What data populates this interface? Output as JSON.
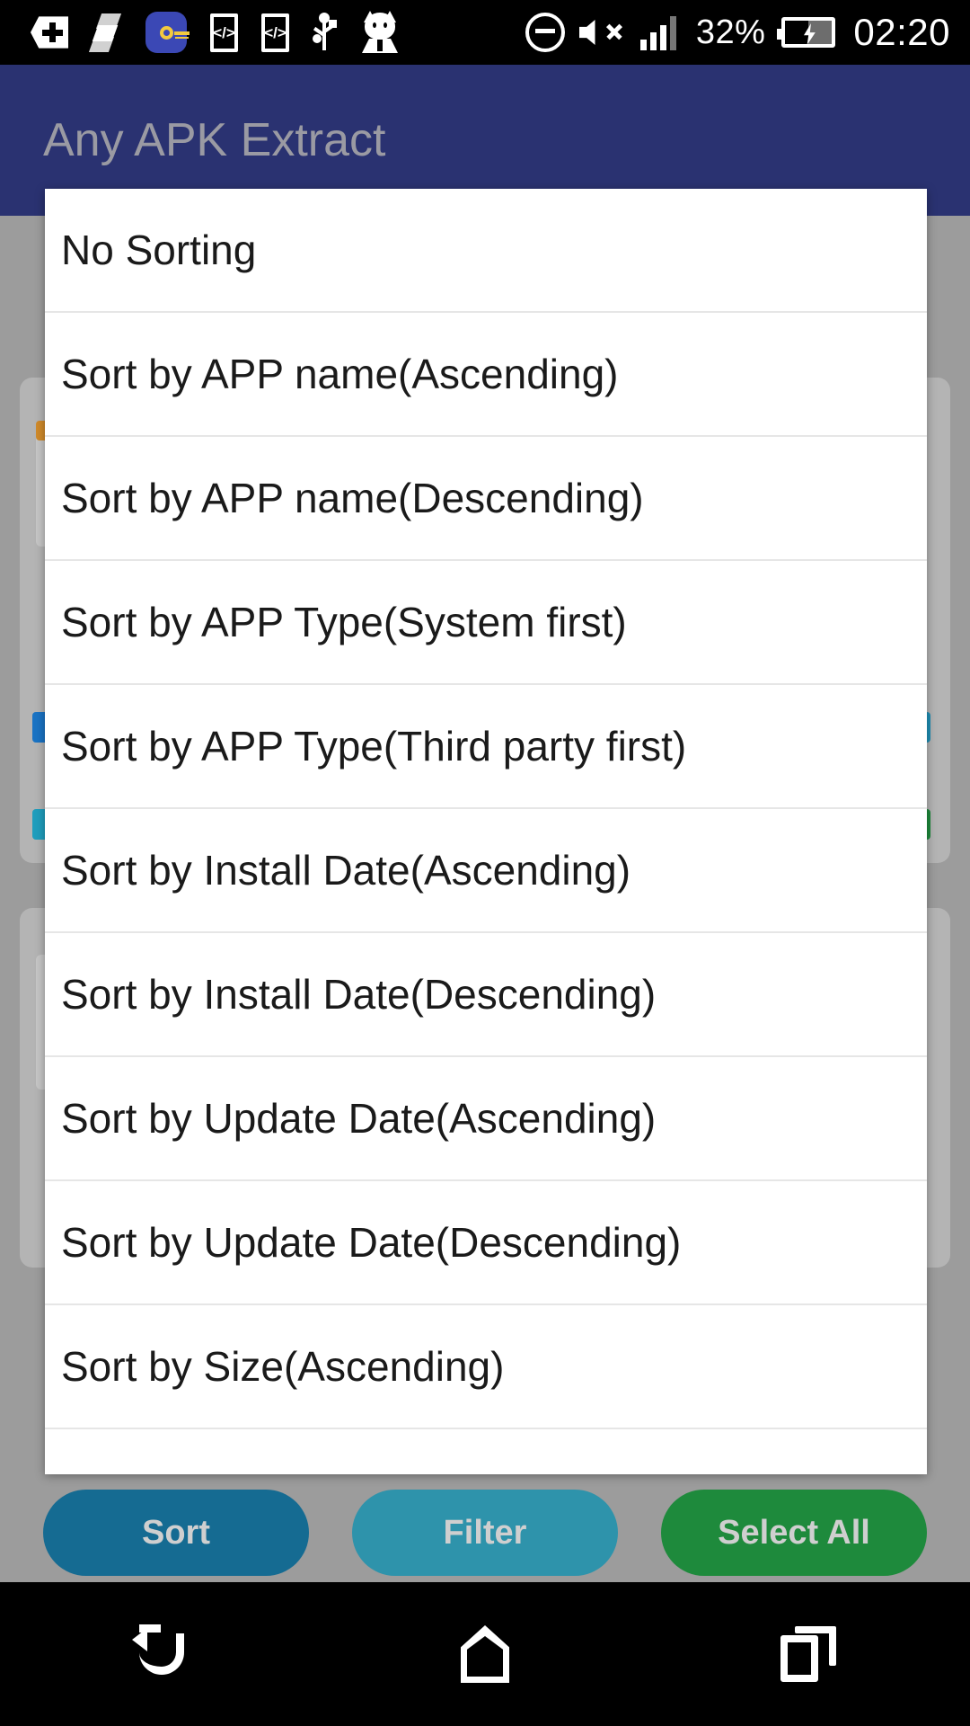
{
  "status_bar": {
    "icons_left": [
      {
        "name": "bitwarden-shield-icon",
        "glyph": "shield-plus"
      },
      {
        "name": "substratum-icon",
        "glyph": "s-layers"
      },
      {
        "name": "password-key-icon",
        "glyph": "key"
      },
      {
        "name": "code-editor-icon-1",
        "glyph": "</>"
      },
      {
        "name": "code-editor-icon-2",
        "glyph": "</>"
      },
      {
        "name": "usb-debugging-icon",
        "glyph": "usb"
      },
      {
        "name": "cat-app-icon",
        "glyph": "cat"
      }
    ],
    "icons_right": [
      {
        "name": "do-not-disturb-icon",
        "glyph": "minus-circle"
      },
      {
        "name": "volume-mute-icon",
        "glyph": "speaker-x"
      },
      {
        "name": "signal-strength-icon",
        "glyph": "signal-bars"
      }
    ],
    "battery_percent": "32%",
    "battery_icon": "battery-charging-icon",
    "clock": "02:20"
  },
  "app_bar": {
    "title": "Any APK Extract"
  },
  "dialog": {
    "name": "sort-options-dialog",
    "items": [
      {
        "label": "No Sorting"
      },
      {
        "label": "Sort by APP name(Ascending)"
      },
      {
        "label": "Sort by APP name(Descending)"
      },
      {
        "label": "Sort by APP Type(System first)"
      },
      {
        "label": "Sort by APP Type(Third party first)"
      },
      {
        "label": "Sort by Install Date(Ascending)"
      },
      {
        "label": "Sort by Install Date(Descending)"
      },
      {
        "label": "Sort by Update Date(Ascending)"
      },
      {
        "label": "Sort by Update Date(Descending)"
      },
      {
        "label": "Sort by Size(Ascending)"
      },
      {
        "label": ""
      }
    ]
  },
  "bottom_bar": {
    "buttons": [
      {
        "name": "sort-button",
        "label": "Sort",
        "color": "#156b92"
      },
      {
        "name": "filter-button",
        "label": "Filter",
        "color": "#2e93ab"
      },
      {
        "name": "select-all-button",
        "label": "Select All",
        "color": "#1e8a3c"
      }
    ],
    "background_fragment": "m"
  },
  "nav_bar": {
    "back": "back-icon",
    "home": "home-icon",
    "recents": "recents-icon"
  },
  "colors": {
    "app_bar": "#2a3271",
    "scrim": "#9c9c9c",
    "dialog_bg": "#ffffff",
    "divider": "#e6e6e6",
    "title_dim": "#9a9aa3"
  }
}
